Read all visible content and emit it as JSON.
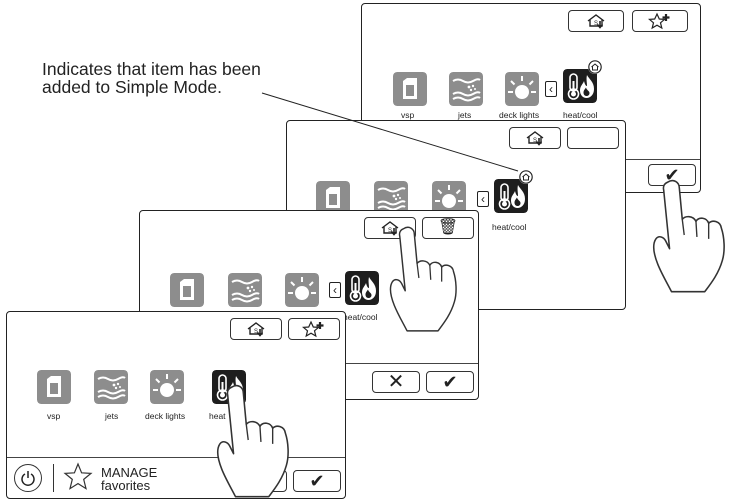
{
  "callout": {
    "line1": "Indicates that item has been",
    "line2": "added to Simple Mode."
  },
  "items": {
    "vsp": "vsp",
    "jets": "jets",
    "deck_lights": "deck lights",
    "heat_cool": "heat/cool",
    "heat_cool_partial": "heat/cool",
    "heat_partial": "heat"
  },
  "footer": {
    "manage_line1": "MANAGE",
    "manage_line2": "favorites"
  },
  "icons": {
    "home_down": "home-arrow-down-icon",
    "star_plus": "star-plus-icon",
    "trash": "trash-icon",
    "cancel": "x-icon",
    "confirm": "checkmark-icon",
    "chevron": "chevron-left-icon",
    "power": "power-icon",
    "star": "star-icon",
    "hand": "pointing-hand-icon"
  },
  "colors": {
    "tile_gray": "#8d8d8d",
    "tile_dark": "#1e1e1e",
    "outline": "#222222"
  }
}
